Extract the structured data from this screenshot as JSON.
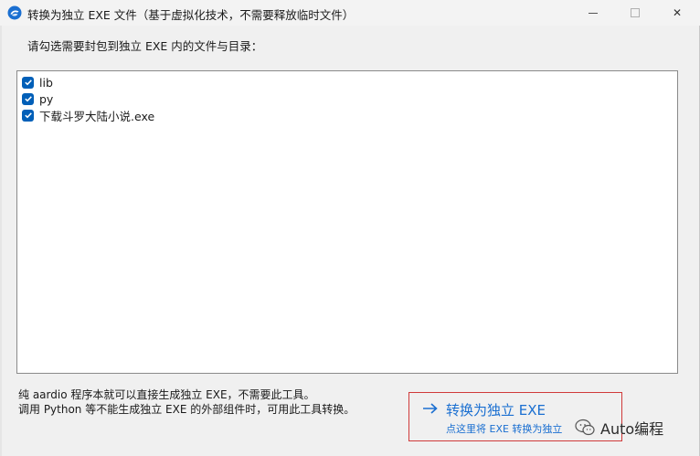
{
  "window": {
    "title": "转换为独立 EXE 文件（基于虚拟化技术，不需要释放临时文件）",
    "icon": "aardio-app-icon",
    "controls": {
      "minimize_icon": "minimize-icon",
      "maximize_icon": "maximize-icon",
      "close_glyph": "✕"
    }
  },
  "prompt": "请勾选需要封包到独立 EXE 内的文件与目录：",
  "files": [
    {
      "name": "lib",
      "checked": true
    },
    {
      "name": "py",
      "checked": true
    },
    {
      "name": "下载斗罗大陆小说.exe",
      "checked": true
    }
  ],
  "note": {
    "line1": "纯 aardio 程序本就可以直接生成独立 EXE，不需要此工具。",
    "line2": "调用 Python 等不能生成独立 EXE 的外部组件时，可用此工具转换。"
  },
  "convert": {
    "label": "转换为独立 EXE",
    "sublabel": "点这里将 EXE 转换为独立",
    "arrow_icon": "arrow-right-icon",
    "color": "#1a6fd1",
    "border_color": "#d03a3a"
  },
  "watermark": {
    "text": "Auto编程",
    "icon": "wechat-icon"
  },
  "colors": {
    "accent": "#005fb8"
  }
}
